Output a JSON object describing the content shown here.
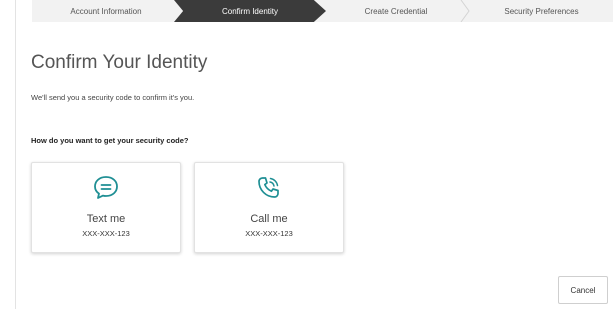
{
  "stepper": {
    "steps": [
      {
        "label": "Account Information",
        "active": false
      },
      {
        "label": "Confirm Identity",
        "active": true
      },
      {
        "label": "Create Credential",
        "active": false
      },
      {
        "label": "Security Preferences",
        "active": false
      }
    ]
  },
  "page": {
    "title": "Confirm Your Identity",
    "subtitle": "We'll send you a security code to confirm it's you.",
    "question": "How do you want to get your security code?"
  },
  "options": [
    {
      "label": "Text me",
      "number": "XXX-XXX-123",
      "icon": "chat-bubble-icon"
    },
    {
      "label": "Call me",
      "number": "XXX-XXX-123",
      "icon": "phone-call-icon"
    }
  ],
  "actions": {
    "cancel_label": "Cancel"
  },
  "colors": {
    "icon_teal": "#1f8f94",
    "active_step": "#3b3b3b"
  }
}
